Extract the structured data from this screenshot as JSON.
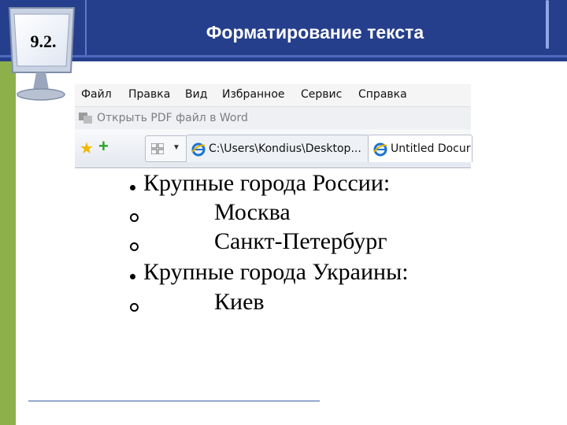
{
  "slide": {
    "section_number": "9.2.",
    "title": "Форматирование текста"
  },
  "browser": {
    "menu": [
      "Файл",
      "Правка",
      "Вид",
      "Избранное",
      "Сервис",
      "Справка"
    ],
    "pdf_bar_label": "Открыть PDF файл в Word",
    "tabs": [
      {
        "label": "C:\\Users\\Kondius\\Desktop...",
        "active": false
      },
      {
        "label": "Untitled Docur",
        "active": true
      }
    ]
  },
  "list": [
    {
      "level": 1,
      "text": "Крупные города России:"
    },
    {
      "level": 2,
      "text": "Москва"
    },
    {
      "level": 2,
      "text": "Санкт-Петербург"
    },
    {
      "level": 1,
      "text": "Крупные города Украины:"
    },
    {
      "level": 2,
      "text": "Киев"
    }
  ],
  "colors": {
    "header": "#263f8c",
    "sidebar": "#8db04a",
    "title_text": "#ffffff"
  }
}
